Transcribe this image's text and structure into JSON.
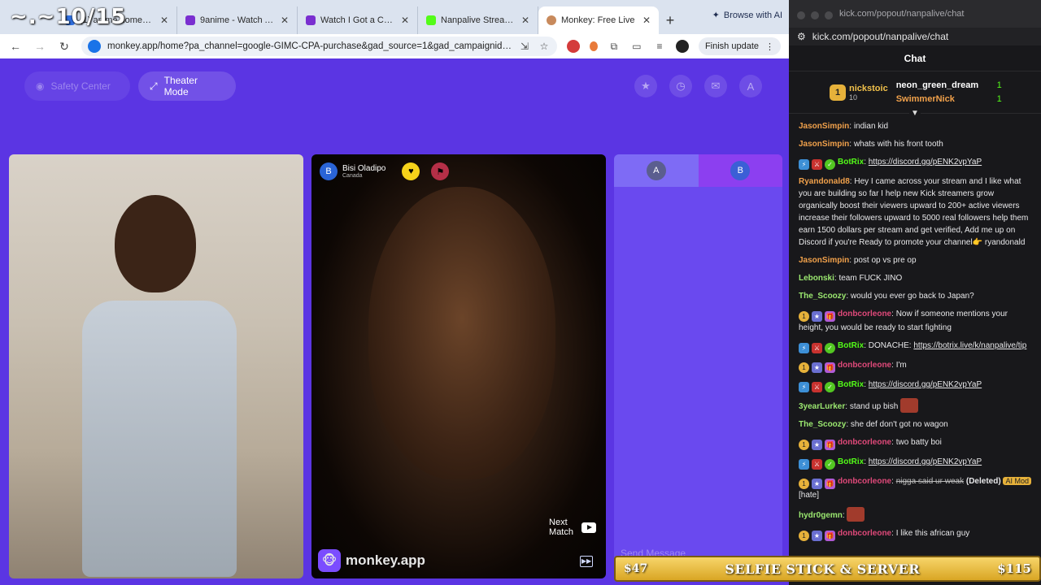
{
  "overlay": {
    "text": "~.~10/15"
  },
  "browser": {
    "tabs": [
      {
        "title": "(1) anime homepage",
        "color": "#2f6fe0"
      },
      {
        "title": "9anime - Watch Anime",
        "color": "#7a2fd0"
      },
      {
        "title": "Watch I Got a Cheat Sk",
        "color": "#7a2fd0"
      },
      {
        "title": "Nanpalive Stream - Wa",
        "color": "#53fc18"
      },
      {
        "title": "Monkey: Free Live",
        "color": "#c88a5c"
      }
    ],
    "ai_label": "Browse with AI",
    "url": "monkey.app/home?pa_channel=google-GIMC-CPA-purchase&gad_source=1&gad_campaignid=2258...",
    "finish_update": "Finish update"
  },
  "monkey": {
    "safety_center": "Safety Center",
    "theater_mode": "Theater Mode",
    "header_icon_a": "A",
    "partner": {
      "name": "Bisi Oladipo",
      "country": "Canada",
      "avatar_letter": "B"
    },
    "next_match": [
      "Next",
      "Match"
    ],
    "brand": "monkey.app",
    "chat_a": "A",
    "chat_b": "B",
    "send_placeholder": "Send Message"
  },
  "kick": {
    "window_url": "kick.com/popout/nanpalive/chat",
    "address": "kick.com/popout/nanpalive/chat",
    "title": "Chat",
    "leaderboard": {
      "top": {
        "rank": "1",
        "name": "nickstoic",
        "count": "10"
      },
      "second": {
        "name": "neon_green_dream",
        "count": "1"
      },
      "third": {
        "name": "SwimmerNick",
        "count": "1"
      }
    },
    "messages": [
      {
        "user": "JasonSimpin",
        "color": "#f1a14b",
        "badges": [],
        "text": "indian kid"
      },
      {
        "user": "JasonSimpin",
        "color": "#f1a14b",
        "badges": [],
        "text": "whats with his front tooth"
      },
      {
        "user": "BotRix",
        "color": "#53fc18",
        "badges": [
          "bot",
          "mod",
          "ver"
        ],
        "link": "https://discord.gg/pENK2vpYaP"
      },
      {
        "user": "Ryandonald8",
        "color": "#f1a14b",
        "badges": [],
        "text": "Hey I came across your stream and I like what you are building so far I help new Kick streamers grow organically boost their viewers upward to 200+ active viewers increase their followers upward to 5000 real followers help them earn 1500 dollars per stream and get verified, Add me up on Discord if you're Ready to promote your channel👉 ryandonald"
      },
      {
        "user": "JasonSimpin",
        "color": "#f1a14b",
        "badges": [],
        "text": "post op vs pre op"
      },
      {
        "user": "Lebonski",
        "color": "#9be870",
        "badges": [],
        "text": "team FUCK JINO"
      },
      {
        "user": "The_Scoozy",
        "color": "#9be870",
        "badges": [],
        "text": "would you ever go back to Japan?"
      },
      {
        "user": "donbcorleone",
        "color": "#e0497a",
        "badges": [
          "one",
          "sub",
          "gift"
        ],
        "text": "Now if someone mentions your height, you would be ready to start fighting"
      },
      {
        "user": "BotRix",
        "color": "#53fc18",
        "badges": [
          "bot",
          "mod",
          "ver"
        ],
        "text": "DONACHE:",
        "link": "https://botrix.live/k/nanpalive/tip"
      },
      {
        "user": "donbcorleone",
        "color": "#e0497a",
        "badges": [
          "one",
          "sub",
          "gift"
        ],
        "text": "I'm"
      },
      {
        "user": "BotRix",
        "color": "#53fc18",
        "badges": [
          "bot",
          "mod",
          "ver"
        ],
        "link": "https://discord.gg/pENK2vpYaP"
      },
      {
        "user": "3yearLurker",
        "color": "#9be870",
        "badges": [],
        "text": "stand up bish",
        "emote": true
      },
      {
        "user": "The_Scoozy",
        "color": "#9be870",
        "badges": [],
        "text": "she def don't got no wagon"
      },
      {
        "user": "donbcorleone",
        "color": "#e0497a",
        "badges": [
          "one",
          "sub",
          "gift"
        ],
        "text": "two batty boi"
      },
      {
        "user": "BotRix",
        "color": "#53fc18",
        "badges": [
          "bot",
          "mod",
          "ver"
        ],
        "link": "https://discord.gg/pENK2vpYaP"
      },
      {
        "user": "donbcorleone",
        "color": "#e0497a",
        "badges": [
          "one",
          "sub",
          "gift"
        ],
        "deleted": "nigga said ur weak",
        "deleted_label": "(Deleted)",
        "ai_mod": "AI Mod",
        "reason": "[hate]"
      },
      {
        "user": "hydr0gemn",
        "color": "#9be870",
        "badges": [],
        "text": "",
        "emote": true
      },
      {
        "user": "donbcorleone",
        "color": "#e0497a",
        "badges": [
          "one",
          "sub",
          "gift"
        ],
        "text": "I like this african guy"
      }
    ]
  },
  "ticker": {
    "left_price": "$47",
    "title": "SELFIE STICK & SERVER",
    "right_price": "$115"
  }
}
